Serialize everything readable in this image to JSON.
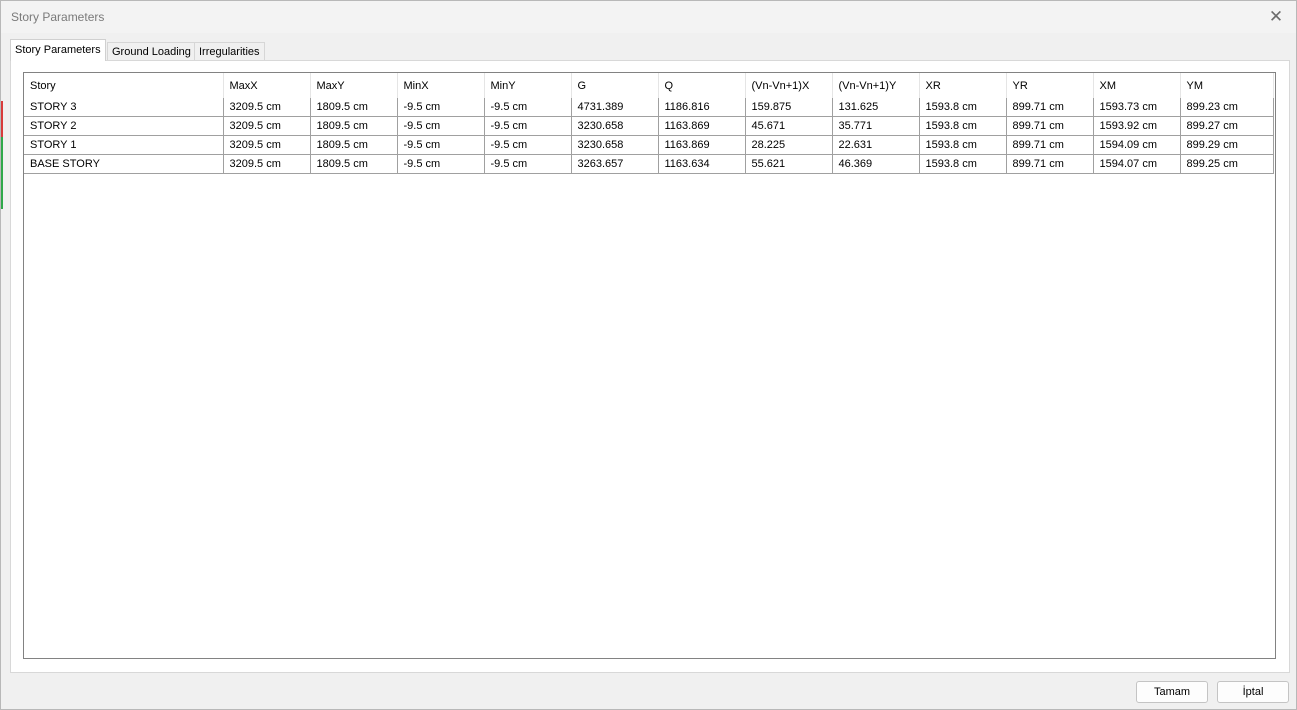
{
  "window": {
    "title": "Story Parameters"
  },
  "tabs": [
    {
      "label": "Story Parameters",
      "active": true
    },
    {
      "label": "Ground Loading",
      "active": false
    },
    {
      "label": "Irregularities",
      "active": false
    }
  ],
  "table": {
    "columns": [
      "Story",
      "MaxX",
      "MaxY",
      "MinX",
      "MinY",
      "G",
      "Q",
      "(Vn-Vn+1)X",
      "(Vn-Vn+1)Y",
      "XR",
      "YR",
      "XM",
      "YM"
    ],
    "rows": [
      [
        "STORY 3",
        "3209.5 cm",
        "1809.5 cm",
        "-9.5 cm",
        "-9.5 cm",
        "4731.389",
        "1186.816",
        "159.875",
        "131.625",
        "1593.8 cm",
        "899.71 cm",
        "1593.73 cm",
        "899.23 cm"
      ],
      [
        "STORY 2",
        "3209.5 cm",
        "1809.5 cm",
        "-9.5 cm",
        "-9.5 cm",
        "3230.658",
        "1163.869",
        "45.671",
        "35.771",
        "1593.8 cm",
        "899.71 cm",
        "1593.92 cm",
        "899.27 cm"
      ],
      [
        "STORY 1",
        "3209.5 cm",
        "1809.5 cm",
        "-9.5 cm",
        "-9.5 cm",
        "3230.658",
        "1163.869",
        "28.225",
        "22.631",
        "1593.8 cm",
        "899.71 cm",
        "1594.09 cm",
        "899.29 cm"
      ],
      [
        "BASE STORY",
        "3209.5 cm",
        "1809.5 cm",
        "-9.5 cm",
        "-9.5 cm",
        "3263.657",
        "1163.634",
        "55.621",
        "46.369",
        "1593.8 cm",
        "899.71 cm",
        "1594.07 cm",
        "899.25 cm"
      ]
    ]
  },
  "buttons": {
    "ok_label": "Tamam",
    "cancel_label": "İptal"
  },
  "colors": {
    "background": "#f0f0f0",
    "grid_border": "#828282",
    "cell_border": "#a0a0a0",
    "title_text": "#7a7a7a"
  },
  "icons": {
    "close": "close-icon"
  }
}
